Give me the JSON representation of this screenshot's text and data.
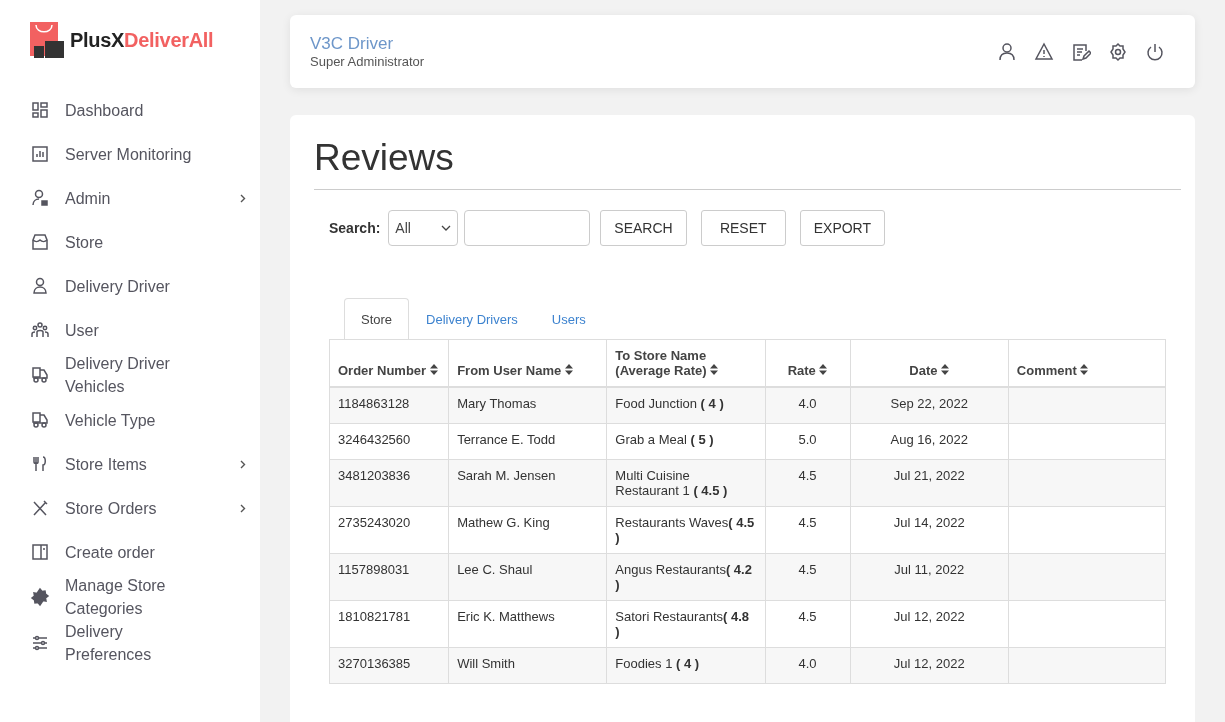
{
  "brand": {
    "name_dark": "PlusX",
    "name_accent": "DeliverAll"
  },
  "sidebar": {
    "items": [
      {
        "label": "Dashboard",
        "has_submenu": false
      },
      {
        "label": "Server Monitoring",
        "has_submenu": false
      },
      {
        "label": "Admin",
        "has_submenu": true
      },
      {
        "label": "Store",
        "has_submenu": false
      },
      {
        "label": "Delivery Driver",
        "has_submenu": false
      },
      {
        "label": "User",
        "has_submenu": false
      },
      {
        "label": "Delivery Driver Vehicles",
        "has_submenu": false
      },
      {
        "label": "Vehicle Type",
        "has_submenu": false
      },
      {
        "label": "Store Items",
        "has_submenu": true
      },
      {
        "label": "Store Orders",
        "has_submenu": true
      },
      {
        "label": "Create order",
        "has_submenu": false
      },
      {
        "label": "Manage Store Categories",
        "has_submenu": false
      },
      {
        "label": "Delivery Preferences",
        "has_submenu": false
      }
    ]
  },
  "header": {
    "user_name": "V3C Driver",
    "role": "Super Administrator"
  },
  "page_title": "Reviews",
  "search": {
    "label": "Search:",
    "filter_value": "All",
    "buttons": [
      "SEARCH",
      "RESET",
      "EXPORT"
    ]
  },
  "tabs": [
    {
      "label": "Store",
      "selected": true
    },
    {
      "label": "Delivery Drivers",
      "selected": false
    },
    {
      "label": "Users",
      "selected": false
    }
  ],
  "table": {
    "columns": [
      "Order Number",
      "From User Name",
      "To Store Name (Average Rate)",
      "Rate",
      "Date",
      "Comment"
    ],
    "rows": [
      {
        "order_number": "1184863128",
        "from_user": "Mary Thomas",
        "to_store": "Food Junction **( 4 )**",
        "rate": "4.0",
        "date": "Sep 22, 2022"
      },
      {
        "order_number": "3246432560",
        "from_user": "Terrance E. Todd",
        "to_store": "Grab a Meal **( 5 )**",
        "rate": "5.0",
        "date": "Aug 16, 2022"
      },
      {
        "order_number": "3481203836",
        "from_user": "Sarah M. Jensen",
        "to_store": "Multi Cuisine Restaurant 1 **( 4.5 )**",
        "rate": "4.5",
        "date": "Jul 21, 2022"
      },
      {
        "order_number": "2735243020",
        "from_user": "Mathew G. King",
        "to_store": "Restaurants Waves**( 4.5 )**",
        "rate": "4.5",
        "date": "Jul 14, 2022"
      },
      {
        "order_number": "1157898031",
        "from_user": "Lee C. Shaul",
        "to_store": "Angus Restaurants**( 4.2 )**",
        "rate": "4.5",
        "date": "Jul 11, 2022"
      },
      {
        "order_number": "1810821781",
        "from_user": "Eric K. Matthews",
        "to_store": "Satori Restaurants**( 4.8 )**",
        "rate": "4.5",
        "date": "Jul 12, 2022"
      },
      {
        "order_number": "3270136385",
        "from_user": "Will Smith",
        "to_store": "Foodies 1 **( 4 )**",
        "rate": "4.0",
        "date": "Jul 12, 2022"
      }
    ]
  }
}
